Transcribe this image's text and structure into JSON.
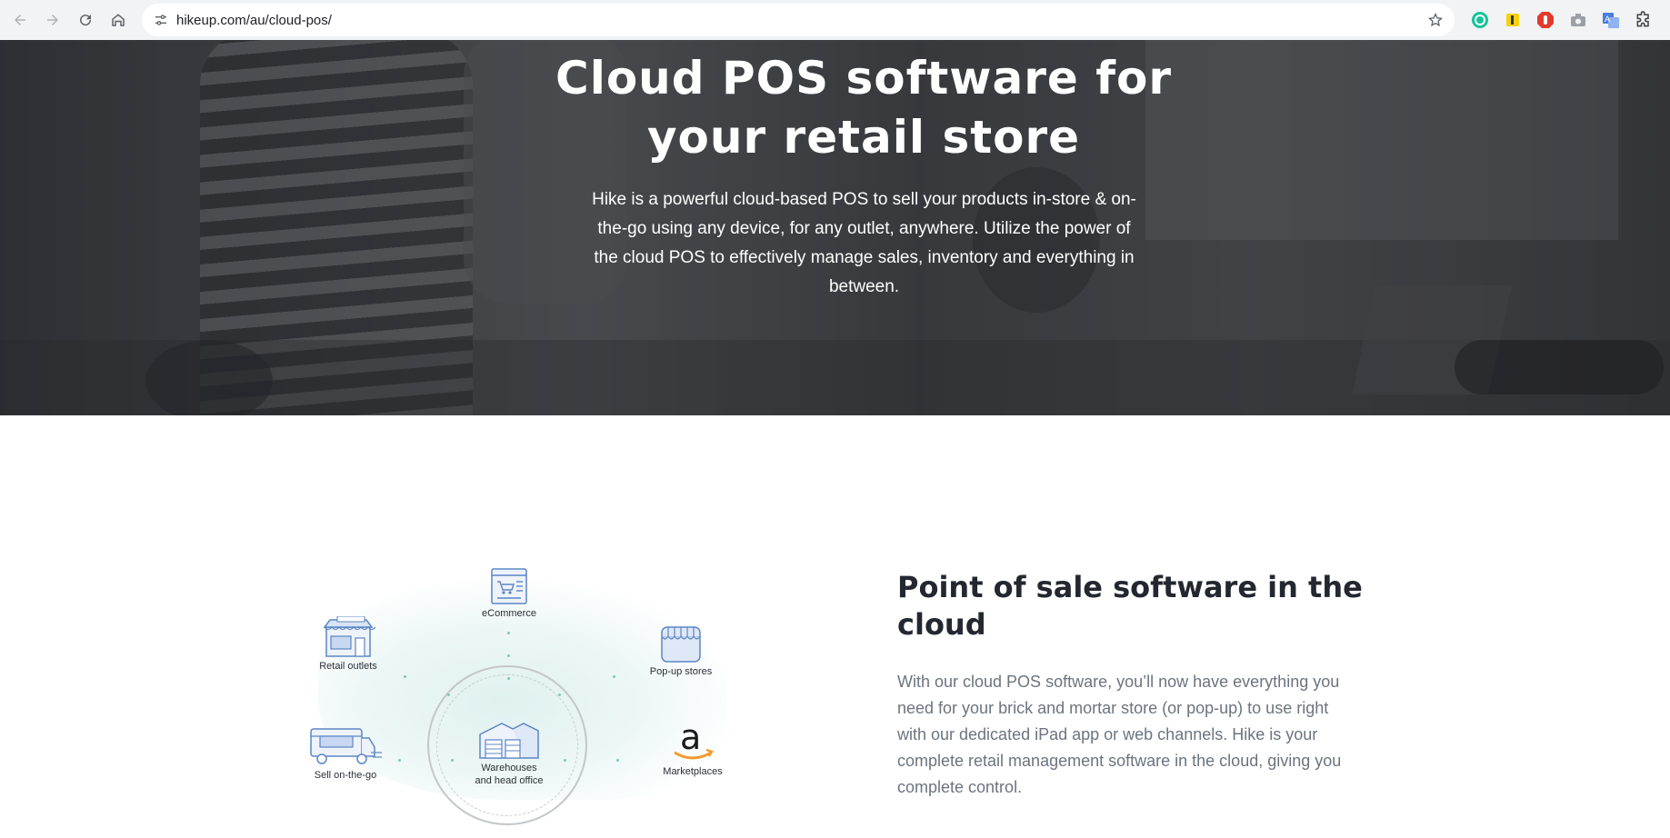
{
  "browser": {
    "url": "hikeup.com/au/cloud-pos/",
    "nav": {
      "back": "arrow-left-icon",
      "forward": "arrow-right-icon",
      "reload": "reload-icon",
      "home": "home-icon"
    },
    "extensions": [
      "grammarly-icon",
      "highlighter-icon",
      "adblock-icon",
      "camera-icon",
      "translate-icon",
      "extensions-puzzle-icon"
    ]
  },
  "hero": {
    "title_line1": "Cloud POS software for",
    "title_line2": "your retail store",
    "description": "Hike is a powerful cloud-based POS to sell your products in-store & on-the-go using any device, for any outlet, anywhere. Utilize the power of the cloud POS to effectively manage sales, inventory and everything in between."
  },
  "diagram": {
    "ecommerce": "eCommerce",
    "retail_outlets": "Retail outlets",
    "popup_stores": "Pop-up stores",
    "sell_on_the_go": "Sell on-the-go",
    "warehouses_line1": "Warehouses",
    "warehouses_line2": "and head office",
    "marketplaces": "Marketplaces",
    "amazon_glyph": "a"
  },
  "section": {
    "title": "Point of sale software in the cloud",
    "text": "With our cloud POS software, you’ll now have everything you need for your brick and mortar store (or pop-up) to use right with our dedicated iPad app or web channels. Hike is your complete retail management software in the cloud, giving you complete control."
  },
  "colors": {
    "toolbar_bg": "#f1f3f4",
    "heading": "#23272f",
    "body_text": "#6b7480",
    "icon_blue": "#5b86c5",
    "accent_teal": "#7fc7bd",
    "amazon_orange": "#f29a2e"
  }
}
